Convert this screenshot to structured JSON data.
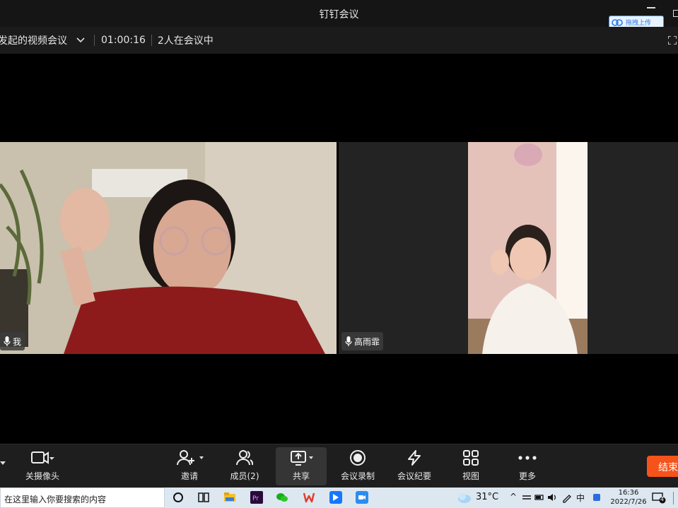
{
  "window": {
    "title": "钉钉会议",
    "upload_label": "拖拽上传"
  },
  "infobar": {
    "meeting_name": "发起的视频会议",
    "duration": "01:00:16",
    "participants": "2人在会议中"
  },
  "videos": [
    {
      "name": "我"
    },
    {
      "name": "高雨霏"
    }
  ],
  "toolbar": {
    "camera": "关摄像头",
    "invite": "邀请",
    "members": "成员(2)",
    "share": "共享",
    "record": "会议录制",
    "minutes": "会议纪要",
    "view": "视图",
    "more": "更多",
    "end": "结束"
  },
  "taskbar": {
    "search_placeholder": "在这里输入你要搜索的内容",
    "weather": "31°C",
    "time": "16:36",
    "date": "2022/7/26",
    "notifications": "4",
    "ime": "中"
  },
  "colors": {
    "accent_end": "#f5531a",
    "titlebar": "#151515",
    "toolbar": "#1e1e1e"
  }
}
